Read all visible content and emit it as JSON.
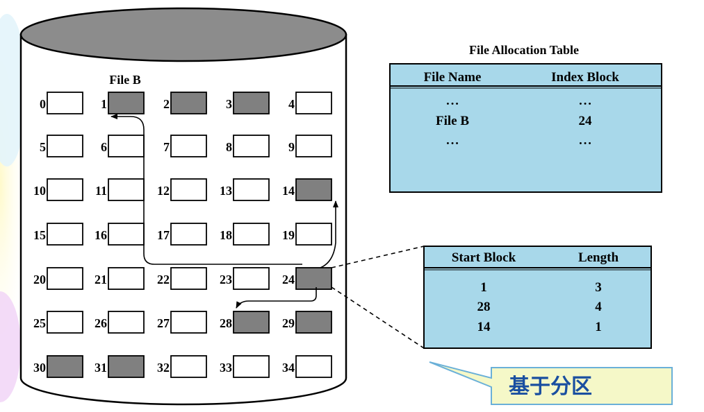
{
  "disk": {
    "file_label": "File B",
    "blocks": [
      {
        "n": "0",
        "filled": false
      },
      {
        "n": "1",
        "filled": true
      },
      {
        "n": "2",
        "filled": true
      },
      {
        "n": "3",
        "filled": true
      },
      {
        "n": "4",
        "filled": false
      },
      {
        "n": "5",
        "filled": false
      },
      {
        "n": "6",
        "filled": false
      },
      {
        "n": "7",
        "filled": false
      },
      {
        "n": "8",
        "filled": false
      },
      {
        "n": "9",
        "filled": false
      },
      {
        "n": "10",
        "filled": false
      },
      {
        "n": "11",
        "filled": false
      },
      {
        "n": "12",
        "filled": false
      },
      {
        "n": "13",
        "filled": false
      },
      {
        "n": "14",
        "filled": true
      },
      {
        "n": "15",
        "filled": false
      },
      {
        "n": "16",
        "filled": false
      },
      {
        "n": "17",
        "filled": false
      },
      {
        "n": "18",
        "filled": false
      },
      {
        "n": "19",
        "filled": false
      },
      {
        "n": "20",
        "filled": false
      },
      {
        "n": "21",
        "filled": false
      },
      {
        "n": "22",
        "filled": false
      },
      {
        "n": "23",
        "filled": false
      },
      {
        "n": "24",
        "filled": true
      },
      {
        "n": "25",
        "filled": false
      },
      {
        "n": "26",
        "filled": false
      },
      {
        "n": "27",
        "filled": false
      },
      {
        "n": "28",
        "filled": true
      },
      {
        "n": "29",
        "filled": true
      },
      {
        "n": "30",
        "filled": true
      },
      {
        "n": "31",
        "filled": true
      },
      {
        "n": "32",
        "filled": false
      },
      {
        "n": "33",
        "filled": false
      },
      {
        "n": "34",
        "filled": false
      }
    ],
    "arrows": [
      {
        "from": "24",
        "to": "1"
      },
      {
        "from": "24",
        "to": "14"
      },
      {
        "from": "24",
        "to": "28"
      }
    ]
  },
  "fat": {
    "title": "File Allocation Table",
    "headers": [
      "File Name",
      "Index Block"
    ],
    "rows": [
      [
        "• • •",
        "• • •"
      ],
      [
        "File B",
        "24"
      ],
      [
        "• • •",
        "• • •"
      ]
    ]
  },
  "index_table": {
    "headers": [
      "Start Block",
      "Length"
    ],
    "rows": [
      [
        "1",
        "3"
      ],
      [
        "28",
        "4"
      ],
      [
        "14",
        "1"
      ]
    ]
  },
  "callout": {
    "text": "基于分区"
  },
  "colors": {
    "table_fill": "#a8d8ea",
    "block_filled": "#808080",
    "disk_top": "#8c8c8c",
    "callout_fill": "#f5f8c8",
    "callout_text": "#1a4fa0",
    "callout_border": "#6ab0d8"
  }
}
